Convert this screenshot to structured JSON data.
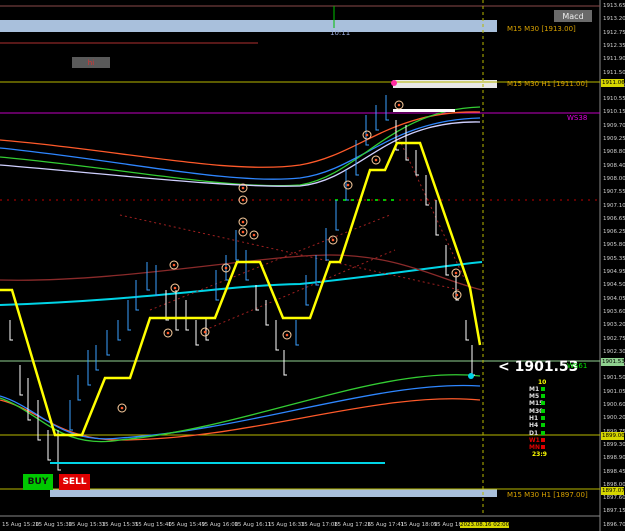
{
  "buttons": {
    "buy": "BUY",
    "sell": "SELL",
    "macd": "Macd",
    "tool": "hi"
  },
  "current_price_label": "<  1901.53",
  "level_labels": [
    {
      "text": "M15 M30  [1913.00]",
      "color": "#d6a000"
    },
    {
      "text": "M15 M30 H1  [1911.00]",
      "color": "#d6a000"
    },
    {
      "text": "WS38",
      "color": "#e000e0"
    },
    {
      "text": "WS61",
      "color": "#00e000"
    },
    {
      "text": "M15 M30 H1  [1897.00]",
      "color": "#d6a000"
    }
  ],
  "top_time_marker": "10:11",
  "price_axis": [
    "1913.65",
    "1913.20",
    "1912.75",
    "1912.35",
    "1911.90",
    "1911.50",
    "1911.06",
    "1910.55",
    "1910.15",
    "1909.70",
    "1909.25",
    "1908.80",
    "1908.40",
    "1908.00",
    "1907.55",
    "1907.10",
    "1906.65",
    "1906.25",
    "1905.80",
    "1905.35",
    "1904.95",
    "1904.50",
    "1904.05",
    "1903.60",
    "1903.20",
    "1902.75",
    "1902.30",
    "1901.90",
    "1901.50",
    "1901.05",
    "1900.60",
    "1900.20",
    "1899.75",
    "1899.30",
    "1898.90",
    "1898.45",
    "1898.00",
    "1897.60",
    "1897.15",
    "1896.70"
  ],
  "axis_tags": [
    {
      "text": "1911.06",
      "bg": "#d6d600"
    },
    {
      "text": "1901.53",
      "bg": "#8fd18f"
    },
    {
      "text": "1899.00",
      "bg": "#d6d600"
    },
    {
      "text": "1897.07",
      "bg": "#d6d600"
    }
  ],
  "time_axis": [
    "15 Aug 15:20",
    "15 Aug 15:30",
    "15 Aug 15:33",
    "15 Aug 15:35",
    "15 Aug 15:40",
    "15 Aug 15:49",
    "15 Aug 16:00",
    "15 Aug 16:11",
    "15 Aug 16:33",
    "15 Aug 17:08",
    "15 Aug 17:26",
    "15 Aug 17:41",
    "15 Aug 18:09",
    "15 Aug 18:27"
  ],
  "time_tag": "2023.08.16 02:00",
  "timeframe_panel": {
    "top_value": "10",
    "rows": [
      {
        "label": "M1",
        "color": "#e0e0e0"
      },
      {
        "label": "M5",
        "color": "#e0e0e0"
      },
      {
        "label": "M15",
        "color": "#e0e0e0"
      },
      {
        "label": "M30",
        "color": "#e0e0e0"
      },
      {
        "label": "H1",
        "color": "#e0e0e0"
      },
      {
        "label": "H4",
        "color": "#e0e0e0"
      },
      {
        "label": "D1",
        "color": "#e0e0e0"
      },
      {
        "label": "W1",
        "color": "#e00000"
      },
      {
        "label": "MN",
        "color": "#e00000"
      }
    ],
    "bottom_value": "23:9"
  },
  "colors": {
    "zigzag": "#ffff00",
    "teal": "#00d4e6",
    "level_line": "#b8b800",
    "ws_line": "#c000c0",
    "band_top": "#a9c0dc",
    "up_bar": "#3aa0ff",
    "down_bar": "#ffffff"
  }
}
